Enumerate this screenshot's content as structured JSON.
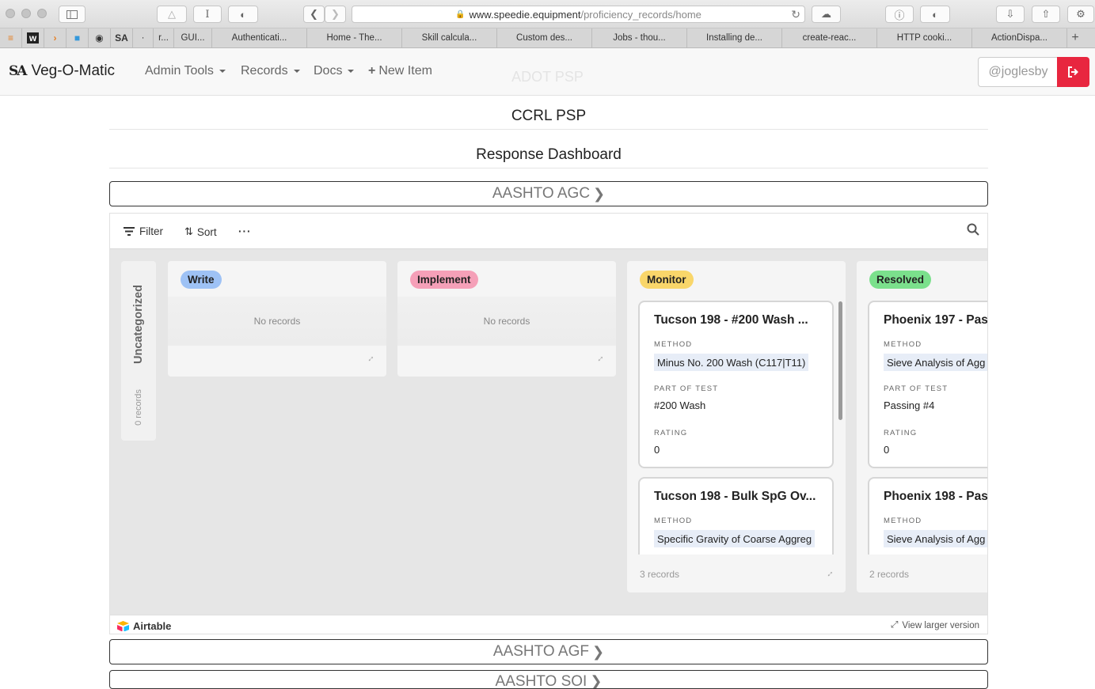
{
  "browser": {
    "url_domain": "www.speedie.equipment",
    "url_path": "/proficiency_records/home",
    "reader_button": "I",
    "tabs": [
      "r...",
      "GUI...",
      "Authenticati...",
      "Home - The...",
      "Skill calcula...",
      "Custom des...",
      "Jobs - thou...",
      "Installing de...",
      "create-reac...",
      "HTTP cooki...",
      "ActionDispa..."
    ]
  },
  "nav": {
    "brand": "Veg-O-Matic",
    "logo_text": "SA",
    "items": [
      "Admin Tools",
      "Records",
      "Docs"
    ],
    "new_item": "New Item",
    "ghost_title": "ADOT PSP",
    "username_placeholder": "@joglesby"
  },
  "page": {
    "title": "CCRL PSP",
    "subtitle": "Response Dashboard",
    "sections": [
      "AASHTO AGC",
      "AASHTO AGF",
      "AASHTO SOI"
    ]
  },
  "embed": {
    "toolbar": {
      "filter": "Filter",
      "sort": "Sort",
      "more": "···"
    },
    "uncategorized": {
      "label": "Uncategorized",
      "count": "0 records"
    },
    "columns": [
      {
        "name": "Write",
        "color": "#9ec2f5",
        "empty": "No records"
      },
      {
        "name": "Implement",
        "color": "#f5a0b8",
        "empty": "No records"
      },
      {
        "name": "Monitor",
        "color": "#f9d66a",
        "count": "3 records",
        "cards": [
          {
            "title": "Tucson 198 - #200 Wash ...",
            "method_label": "METHOD",
            "method": "Minus No. 200 Wash (C117|T11)",
            "part_label": "PART OF TEST",
            "part": "#200 Wash",
            "rating_label": "RATING",
            "rating": "0"
          },
          {
            "title": "Tucson 198 - Bulk SpG Ov...",
            "method_label": "METHOD",
            "method": "Specific Gravity of Coarse Aggreg"
          }
        ]
      },
      {
        "name": "Resolved",
        "color": "#7be08c",
        "count": "2 records",
        "cards": [
          {
            "title": "Phoenix 197 - Pas",
            "method_label": "METHOD",
            "method": "Sieve Analysis of Agg",
            "part_label": "PART OF TEST",
            "part": "Passing #4",
            "rating_label": "RATING",
            "rating": "0"
          },
          {
            "title": "Phoenix 198 - Pas",
            "method_label": "METHOD",
            "method": "Sieve Analysis of Agg"
          }
        ]
      }
    ],
    "footer": {
      "brand": "Airtable",
      "view_larger": "View larger version"
    }
  }
}
